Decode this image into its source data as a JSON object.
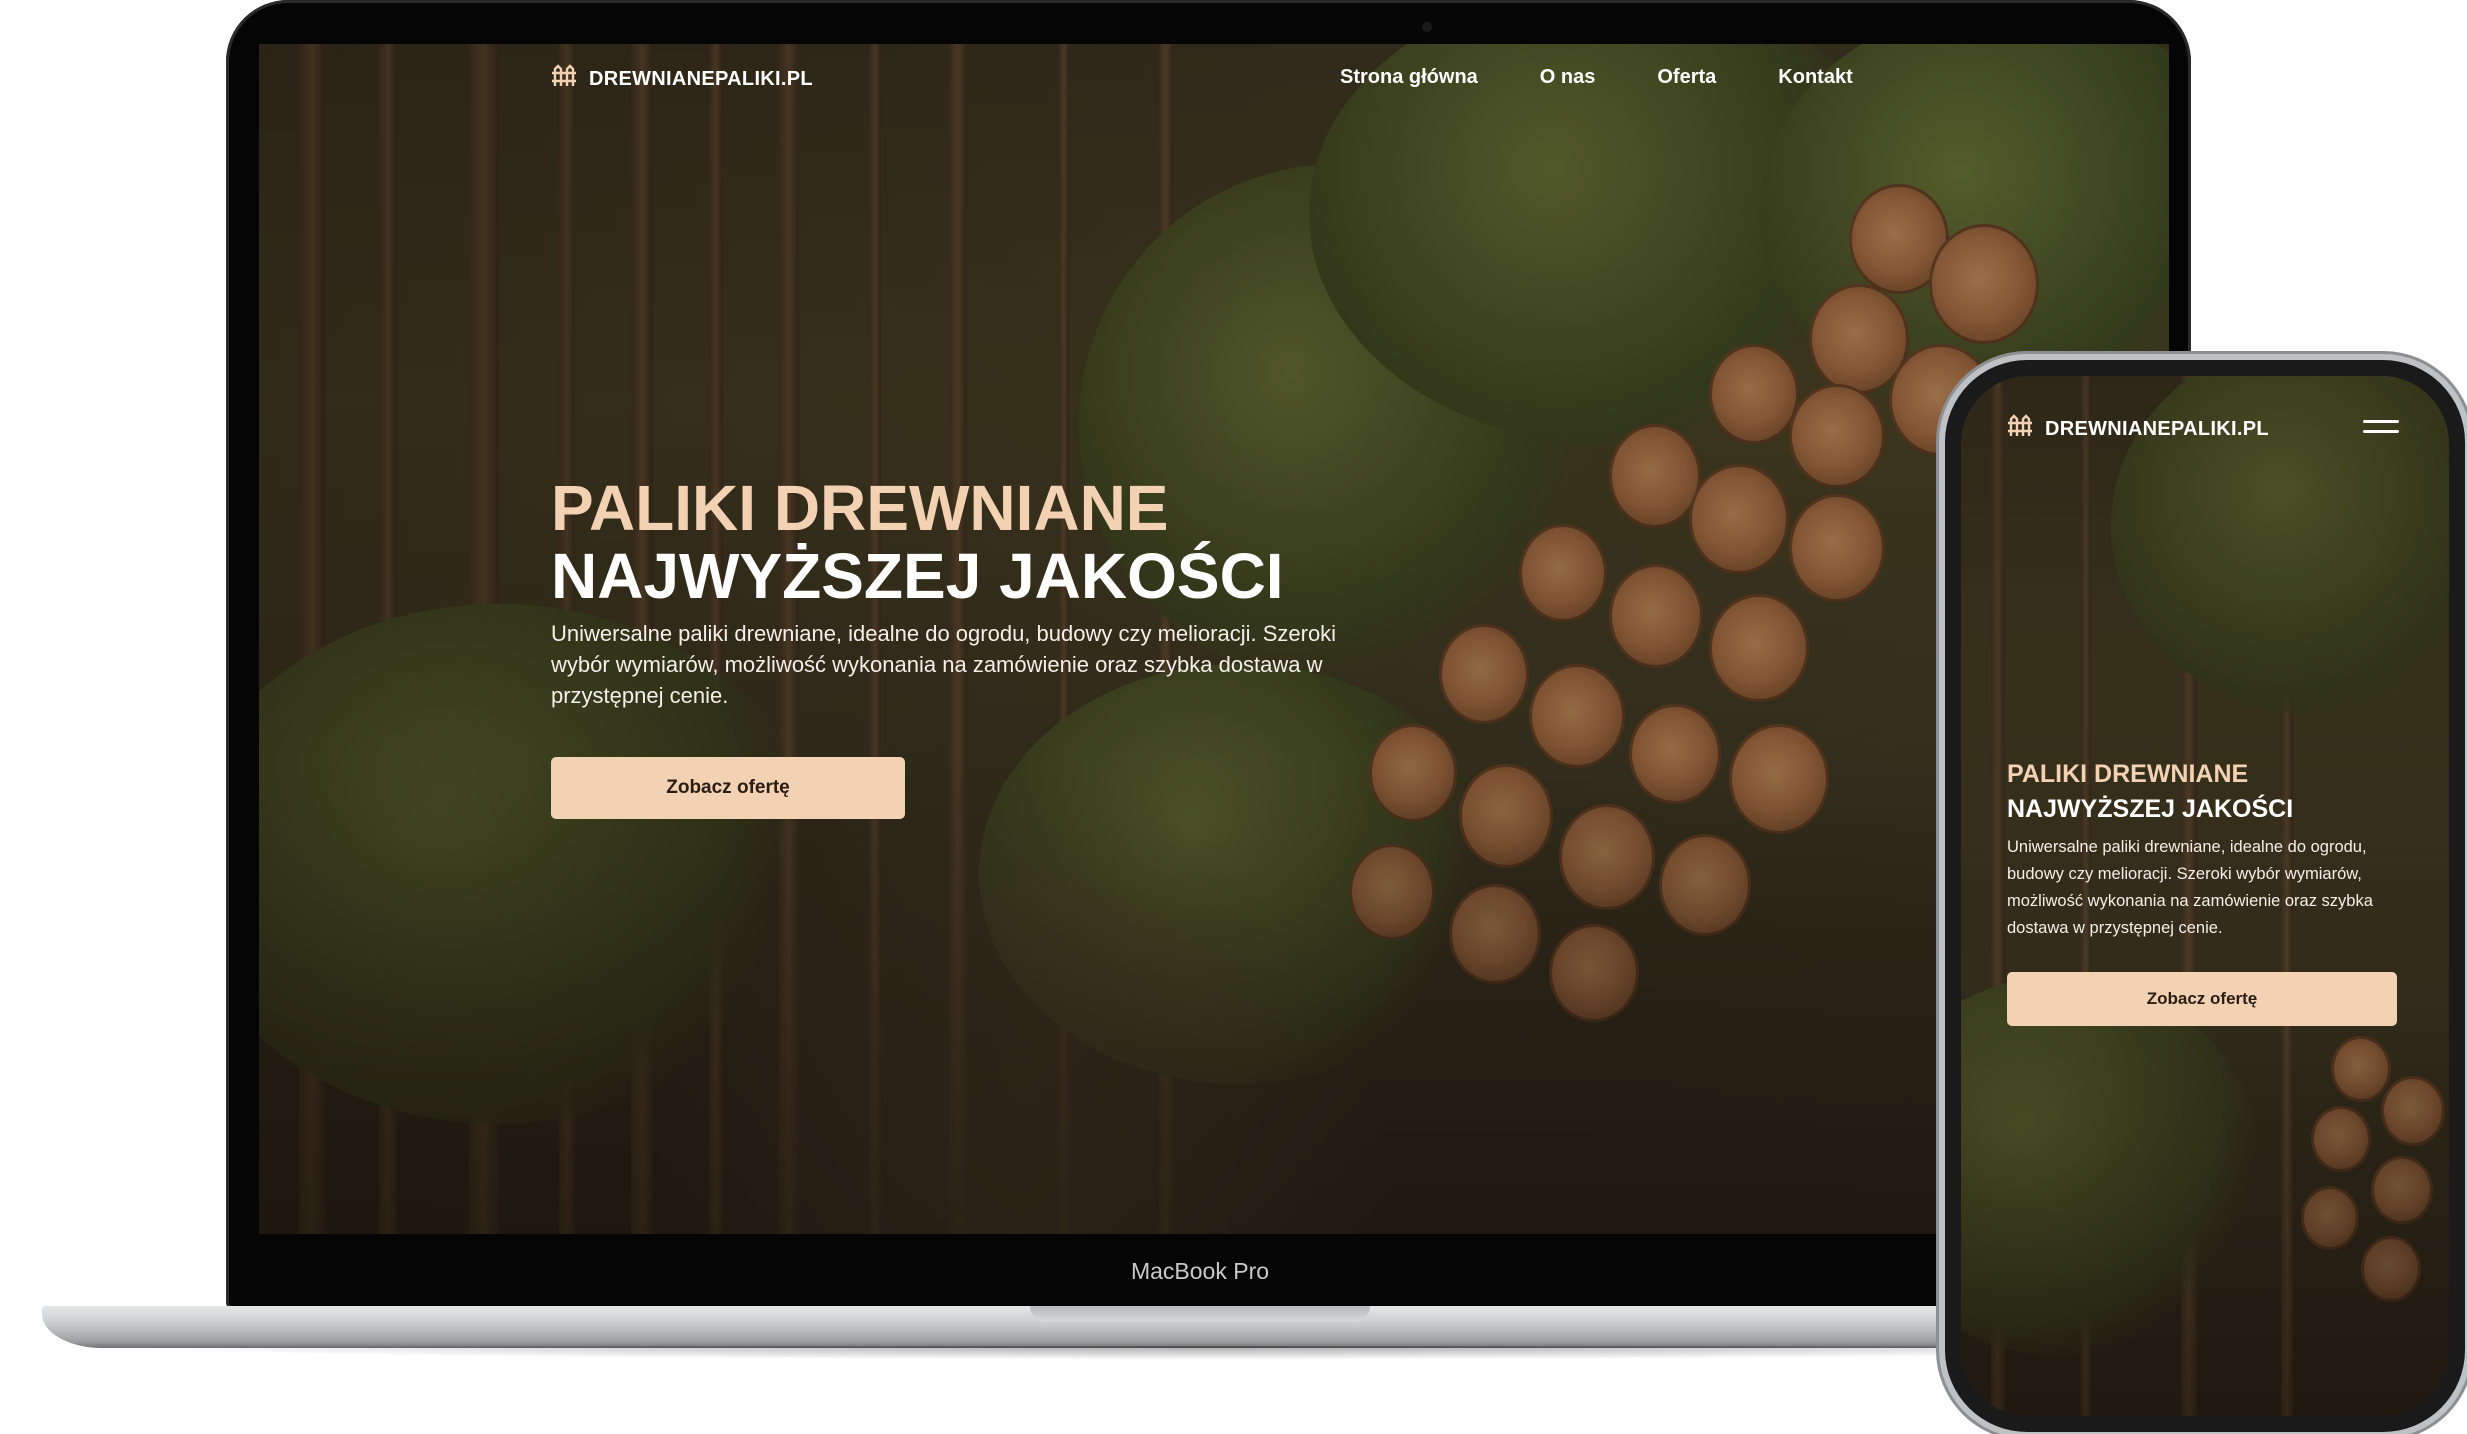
{
  "brand": {
    "name": "DREWNIANEPALIKI.PL",
    "icon": "fence-icon"
  },
  "nav": {
    "items": [
      "Strona główna",
      "O nas",
      "Oferta",
      "Kontakt"
    ]
  },
  "hero": {
    "title_line1": "PALIKI DREWNIANE",
    "title_line2": "NAJWYŻSZEJ JAKOŚCI",
    "description": "Uniwersalne paliki drewniane, idealne do ogrodu, budowy czy melioracji. Szeroki wybór wymiarów, możliwość wykonania na zamówienie oraz szybka dostawa w przystępnej cenie.",
    "cta_label": "Zobacz ofertę"
  },
  "device": {
    "laptop_label": "MacBook Pro"
  },
  "mobile": {
    "menu_icon": "hamburger-menu-icon"
  },
  "colors": {
    "accent": "#f3d2b3",
    "text": "#ffffff",
    "cta_text": "#2a1d12"
  }
}
